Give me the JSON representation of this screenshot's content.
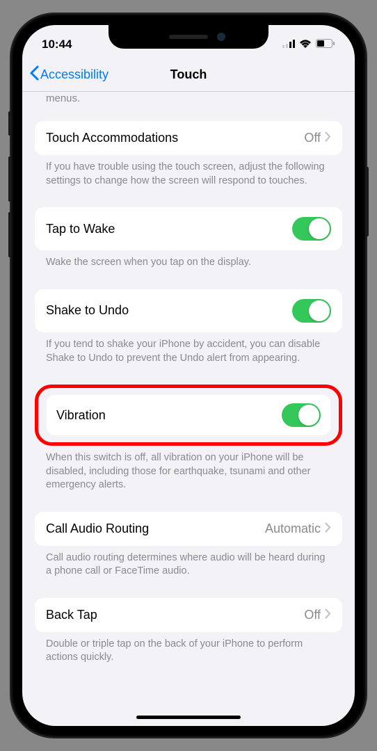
{
  "status": {
    "time": "10:44"
  },
  "nav": {
    "back": "Accessibility",
    "title": "Touch"
  },
  "sections": {
    "truncated": "menus.",
    "touch_accommodations": {
      "label": "Touch Accommodations",
      "value": "Off",
      "footer": "If you have trouble using the touch screen, adjust the following settings to change how the screen will respond to touches."
    },
    "tap_to_wake": {
      "label": "Tap to Wake",
      "footer": "Wake the screen when you tap on the display."
    },
    "shake_to_undo": {
      "label": "Shake to Undo",
      "footer": "If you tend to shake your iPhone by accident, you can disable Shake to Undo to prevent the Undo alert from appearing."
    },
    "vibration": {
      "label": "Vibration",
      "footer": "When this switch is off, all vibration on your iPhone will be disabled, including those for earthquake, tsunami and other emergency alerts."
    },
    "call_audio_routing": {
      "label": "Call Audio Routing",
      "value": "Automatic",
      "footer": "Call audio routing determines where audio will be heard during a phone call or FaceTime audio."
    },
    "back_tap": {
      "label": "Back Tap",
      "value": "Off",
      "footer": "Double or triple tap on the back of your iPhone to perform actions quickly."
    }
  }
}
